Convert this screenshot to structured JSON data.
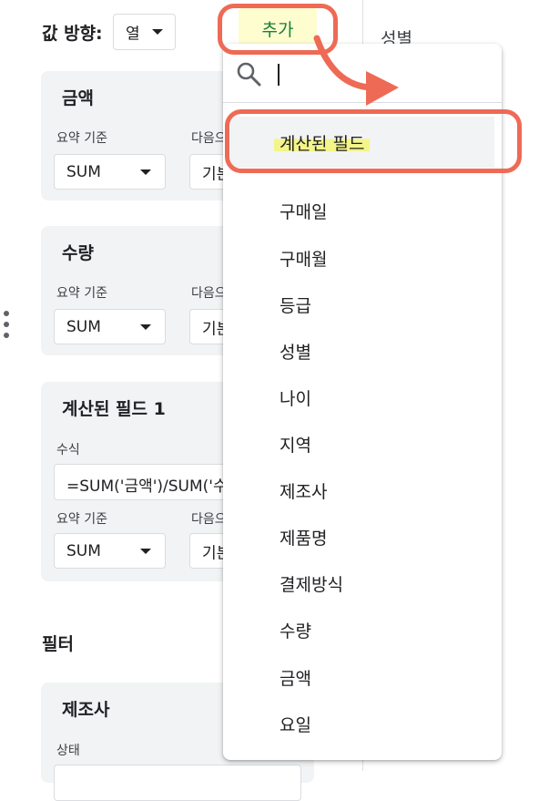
{
  "values": {
    "label": "값 방향:",
    "direction_value": "열"
  },
  "add_button": {
    "label": "추가"
  },
  "right_panel": {
    "partial_label": "성별"
  },
  "cards": [
    {
      "title": "금액",
      "summarize_label": "요약 기준",
      "summarize_value": "SUM",
      "show_as_label": "다음으",
      "show_as_value": "기본"
    },
    {
      "title": "수량",
      "summarize_label": "요약 기준",
      "summarize_value": "SUM",
      "show_as_label": "다음으",
      "show_as_value": "기본"
    },
    {
      "title": "계산된 필드 1",
      "formula_label": "수식",
      "formula_value": "=SUM('금액')/SUM('수",
      "summarize_label": "요약 기준",
      "summarize_value": "SUM",
      "show_as_label": "다음으",
      "show_as_value": "기본"
    }
  ],
  "filters": {
    "label": "필터",
    "card": {
      "title": "제조사",
      "status_label": "상태"
    }
  },
  "dropdown": {
    "search_placeholder": "",
    "calculated_field": "계산된 필드",
    "fields": [
      "구매일",
      "구매월",
      "등급",
      "성별",
      "나이",
      "지역",
      "제조사",
      "제품명",
      "결제방식",
      "수량",
      "금액",
      "요일"
    ]
  },
  "colors": {
    "annotation": "#ee6a55",
    "highlight": "#f3f58a",
    "add_text": "#188038"
  }
}
